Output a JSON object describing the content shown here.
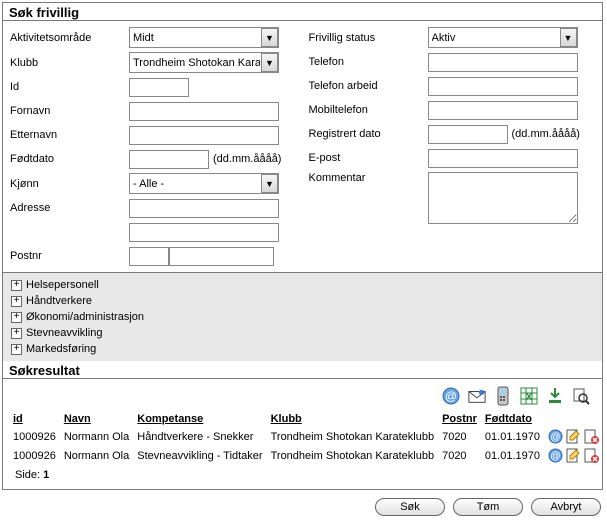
{
  "title": "Søk frivillig",
  "left": {
    "aktivitetsomrade": {
      "label": "Aktivitetsområde",
      "value": "Midt"
    },
    "klubb": {
      "label": "Klubb",
      "value": "Trondheim Shotokan Karat"
    },
    "id": {
      "label": "Id",
      "value": ""
    },
    "fornavn": {
      "label": "Fornavn",
      "value": ""
    },
    "etternavn": {
      "label": "Etternavn",
      "value": ""
    },
    "fodtdato": {
      "label": "Fødtdato",
      "value": "",
      "hint": "(dd.mm.åååå)"
    },
    "kjonn": {
      "label": "Kjønn",
      "value": "- Alle -"
    },
    "adresse": {
      "label": "Adresse",
      "value": ""
    },
    "adresse2": {
      "value": ""
    },
    "postnr": {
      "label": "Postnr",
      "code": "",
      "city": ""
    }
  },
  "right": {
    "status": {
      "label": "Frivillig status",
      "value": "Aktiv"
    },
    "telefon": {
      "label": "Telefon",
      "value": ""
    },
    "telefon_arbeid": {
      "label": "Telefon arbeid",
      "value": ""
    },
    "mobil": {
      "label": "Mobiltelefon",
      "value": ""
    },
    "regdato": {
      "label": "Registrert dato",
      "value": "",
      "hint": "(dd.mm.åååå)"
    },
    "epost": {
      "label": "E-post",
      "value": ""
    },
    "kommentar": {
      "label": "Kommentar",
      "value": ""
    }
  },
  "tree": [
    "Helsepersonell",
    "Håndtverkere",
    "Økonomi/administrasjon",
    "Stevneavvikling",
    "Markedsføring"
  ],
  "results_title": "Søkresultat",
  "columns": {
    "id": "id",
    "navn": "Navn",
    "kompetanse": "Kompetanse",
    "klubb": "Klubb",
    "postnr": "Postnr",
    "fodtdato": "Fødtdato"
  },
  "rows": [
    {
      "id": "1000926",
      "navn": "Normann Ola",
      "kompetanse": "Håndtverkere - Snekker",
      "klubb": "Trondheim Shotokan Karateklubb",
      "postnr": "7020",
      "fodtdato": "01.01.1970"
    },
    {
      "id": "1000926",
      "navn": "Normann Ola",
      "kompetanse": "Stevneavvikling - Tidtaker",
      "klubb": "Trondheim Shotokan Karateklubb",
      "postnr": "7020",
      "fodtdato": "01.01.1970"
    }
  ],
  "pager": {
    "label": "Side:",
    "page": "1"
  },
  "buttons": {
    "sok": "Søk",
    "tom": "Tøm",
    "avbryt": "Avbryt"
  }
}
